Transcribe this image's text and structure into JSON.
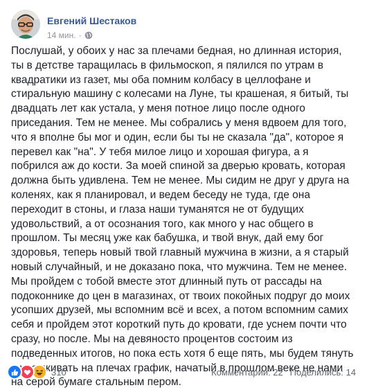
{
  "post": {
    "author": "Евгений Шестаков",
    "time": "14 мин.",
    "separator": "·",
    "privacy_icon": "globe-icon",
    "text": "Послушай, у обоих у нас за плечами бедная, но длинная история, ты в детстве таращилась в фильмоскоп, я пялился по утрам в квадратики из газет, мы оба помним колбасу в целлофане и стиральную машину с колесами на Луне, ты крашеная, я битый, ты двадцать лет как устала, у меня потное лицо после одного приседания. Тем не менее. Мы собрались у меня вдвоем для того, что я вполне бы мог и один, если бы ты не сказала \"да\", которое я перевел как \"на\". У тебя милое лицо и хорошая фигура, а я побрился аж до кости. За моей спиной за дверью кровать, которая должна быть удивлена. Тем не менее. Мы сидим не друг у друга на коленях, как я планировал, и ведем беседу не туда, где она переходит в стоны, и глаза наши туманятся не от будущих удовольствий, а от осознания того, как много у нас общего в прошлом. Ты месяц уже как бабушка, и твой внук, дай ему бог здоровья, теперь новый твой главный мужчина в жизни, а я старый новый случайный, и не доказано пока, что мужчина. Тем не менее. Мы пройдем с тобой вместе этот длинный путь от рассады на подоконнике до цен в магазинах, от твоих покойных подруг до моих усопших друзей, мы вспомним всё и всех, а потом вспомним самих себя и пройдем этот короткий путь до кровати, где уснем почти что сразу, но после. Мы на девяносто процентов состоим из подведенных итогов, но пока есть хотя б еще пять, мы будем тянуть и удерживать на плечах график, начатый в прошлом веке не нами на серой бумаге стальным пером."
  },
  "footer": {
    "reactions": [
      "like-icon",
      "love-icon",
      "haha-icon"
    ],
    "reaction_count": "310",
    "comments": "Комментарии: 22",
    "shares": "Поделились: 14"
  },
  "colors": {
    "author": "#385898",
    "meta": "#90949c",
    "text": "#1d2129",
    "like": "#1877f2",
    "love": "#f33e58",
    "haha": "#f7b125"
  }
}
